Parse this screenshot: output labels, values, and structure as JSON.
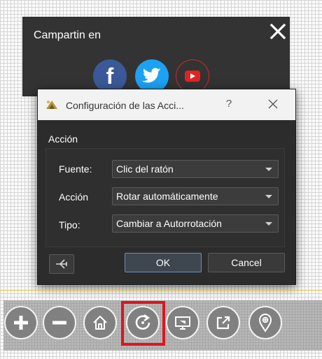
{
  "share": {
    "title": "Campartin en",
    "networks": [
      {
        "name": "facebook",
        "glyph": "f",
        "color": "#3b5998"
      },
      {
        "name": "twitter",
        "color": "#1da1f2"
      },
      {
        "name": "youtube",
        "color": "#e02424"
      }
    ]
  },
  "dialog": {
    "title": "Configuración de las Acci...",
    "help_label": "?",
    "group_label": "Acción",
    "rows": [
      {
        "label": "Fuente:",
        "value": "Clic del ratón"
      },
      {
        "label": "Acción",
        "value": "Rotar automáticamente"
      },
      {
        "label": "Tipo:",
        "value": "Cambiar a Autorrotación"
      }
    ],
    "ok_label": "OK",
    "cancel_label": "Cancel"
  },
  "toolbar": {
    "buttons": [
      "zoom-in",
      "zoom-out",
      "home",
      "autorotate",
      "fullscreen",
      "open-external",
      "location"
    ],
    "highlight_color": "#e0141e"
  },
  "colors": {
    "dialog_bg": "#2c2c2c",
    "ok_border": "#6b8fb7",
    "accent_line": "#e6c13a"
  }
}
